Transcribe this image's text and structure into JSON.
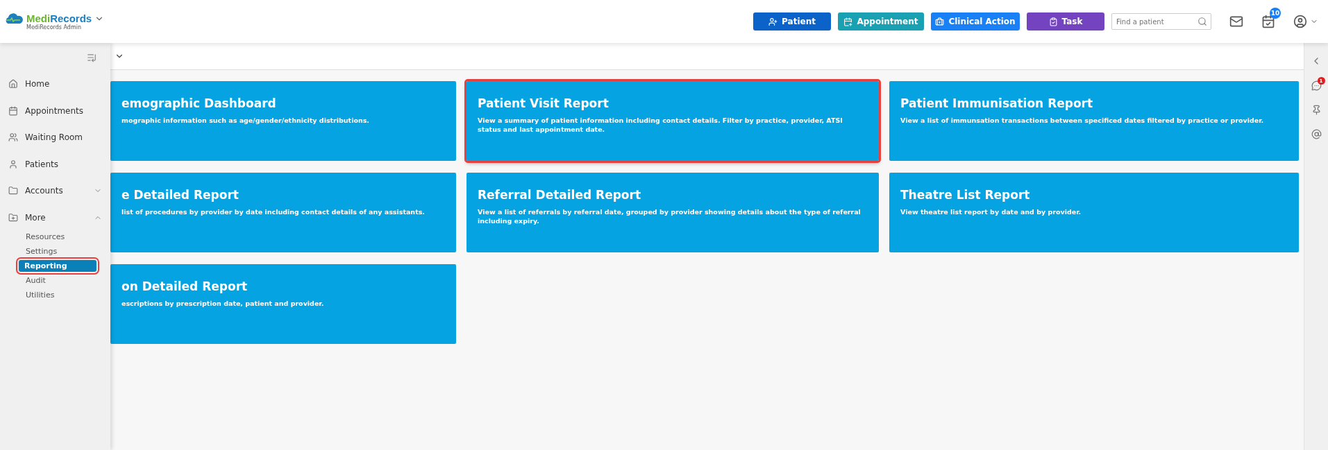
{
  "brand": {
    "name_part_1": "Medi",
    "name_part_2": "Records",
    "subtitle": "MediRecords Admin"
  },
  "header_buttons": [
    {
      "label": "Patient",
      "kind": "patient",
      "color": "#0b62c9"
    },
    {
      "label": "Appointment",
      "kind": "appointment",
      "color": "#1aa0b3"
    },
    {
      "label": "Clinical Action",
      "kind": "clinical",
      "color": "#1a80f5"
    },
    {
      "label": "Task",
      "kind": "task",
      "color": "#7444c0"
    }
  ],
  "search": {
    "placeholder": "Find a patient"
  },
  "tasks_badge": "10",
  "sidebar": {
    "items": [
      {
        "label": "Home"
      },
      {
        "label": "Appointments"
      },
      {
        "label": "Waiting Room"
      },
      {
        "label": "Patients"
      },
      {
        "label": "Accounts",
        "expanded": false
      },
      {
        "label": "More",
        "expanded": true,
        "children": [
          {
            "label": "Resources",
            "selected": false
          },
          {
            "label": "Settings",
            "selected": false
          },
          {
            "label": "Reporting",
            "selected": true
          },
          {
            "label": "Audit",
            "selected": false
          },
          {
            "label": "Utilities",
            "selected": false
          }
        ]
      }
    ]
  },
  "cards": [
    {
      "title": "emographic Dashboard",
      "description": "mographic information such as age/gender/ethnicity distributions.",
      "highlighted": false
    },
    {
      "title": "Patient Visit Report",
      "description": "View a summary of patient information including contact details. Filter by practice, provider, ATSI status and last appointment date.",
      "highlighted": true
    },
    {
      "title": "Patient Immunisation Report",
      "description": "View a list of immunsation transactions between specificed dates filtered by practice or provider.",
      "highlighted": false
    },
    {
      "title": "e Detailed Report",
      "description": "list of procedures by provider by date including contact details of any assistants.",
      "highlighted": false
    },
    {
      "title": "Referral Detailed Report",
      "description": "View a list of referrals by referral date, grouped by provider showing details about the type of referral including expiry.",
      "highlighted": false
    },
    {
      "title": "Theatre List Report",
      "description": "View theatre list report by date and by provider.",
      "highlighted": false
    },
    {
      "title": "on Detailed Report",
      "description": "escriptions by prescription date, patient and provider.",
      "highlighted": false
    }
  ],
  "right_rail": {
    "messages_badge": "1"
  }
}
